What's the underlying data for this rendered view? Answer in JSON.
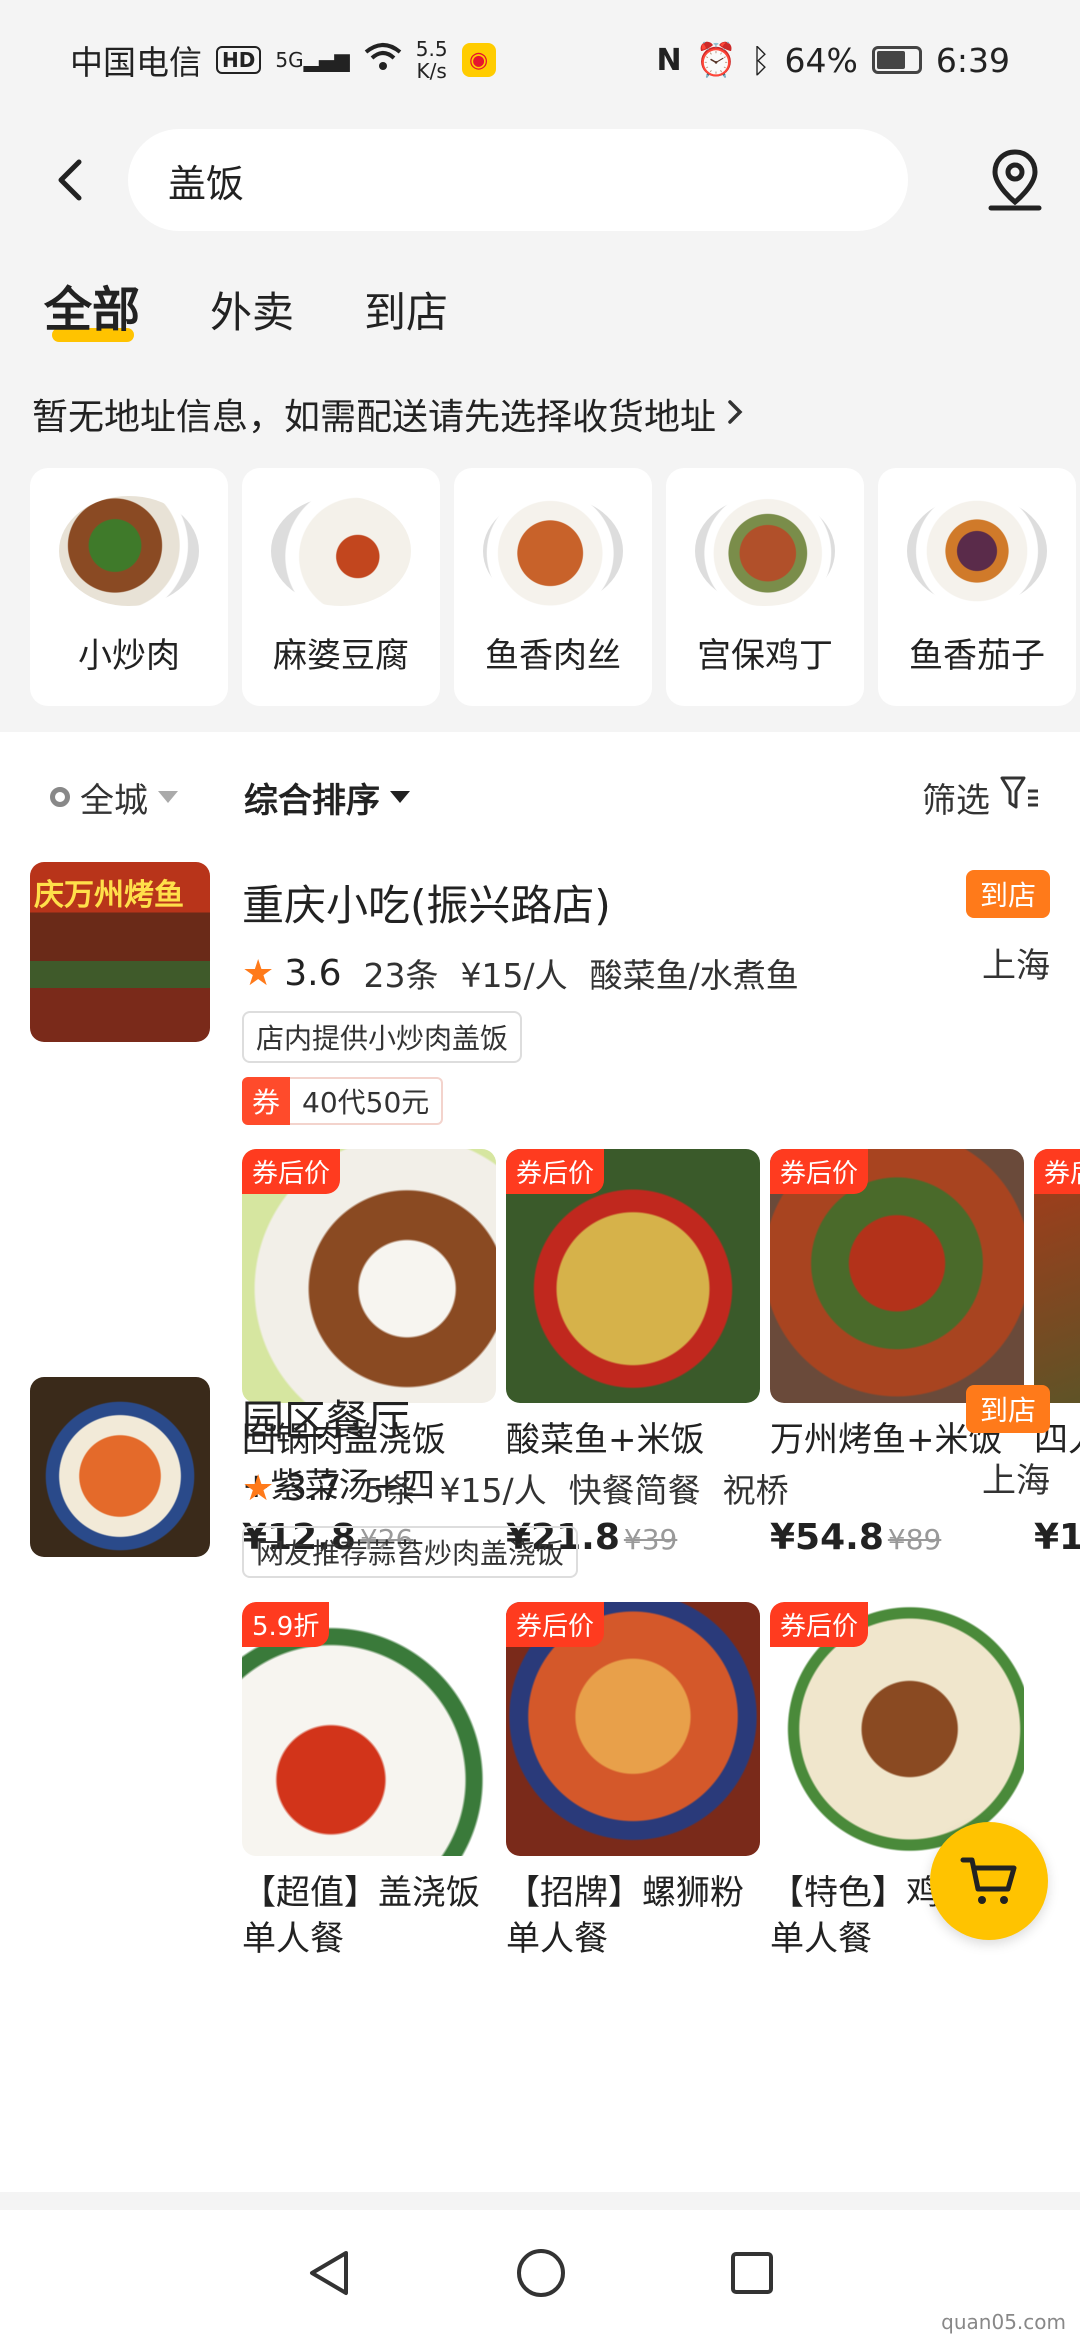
{
  "status_bar": {
    "carrier": "中国电信",
    "hd": "HD",
    "signal": "5G",
    "net_speed_top": "5.5",
    "net_speed_bottom": "K/s",
    "battery": "64%",
    "time": "6:39"
  },
  "search": {
    "query": "盖饭"
  },
  "tabs": [
    {
      "label": "全部",
      "active": true
    },
    {
      "label": "外卖",
      "active": false
    },
    {
      "label": "到店",
      "active": false
    }
  ],
  "address_hint": "暂无地址信息，如需配送请先选择收货地址",
  "dish_categories": [
    {
      "label": "小炒肉"
    },
    {
      "label": "麻婆豆腐"
    },
    {
      "label": "鱼香肉丝"
    },
    {
      "label": "宫保鸡丁"
    },
    {
      "label": "鱼香茄子"
    }
  ],
  "filters": {
    "city": "全城",
    "sort": "综合排序",
    "screen": "筛选"
  },
  "shops": [
    {
      "name": "重庆小吃(振兴路店)",
      "tag": "到店",
      "city": "上海",
      "rating": "3.6",
      "reviews": "23条",
      "price_per": "¥15/人",
      "category": "酸菜鱼/水煮鱼",
      "thumb_text": "庆万州烤鱼",
      "rec": "店内提供小炒肉盖饭",
      "coupon_mark": "券",
      "coupon_text": "40代50元",
      "products": [
        {
          "badge": "券后价",
          "name": "回锅肉盖浇饭+紫菜汤+四川...",
          "price": "¥12.8",
          "orig": "¥26"
        },
        {
          "badge": "券后价",
          "name": "酸菜鱼+米饭",
          "price": "¥21.8",
          "orig": "¥39"
        },
        {
          "badge": "券后价",
          "name": "万州烤鱼+米饭",
          "price": "¥54.8",
          "orig": "¥89"
        },
        {
          "badge": "券后",
          "name": "四人",
          "price": "¥1",
          "orig": ""
        }
      ]
    },
    {
      "name": "园区餐厅",
      "tag": "到店",
      "city": "上海",
      "rating": "3.7",
      "reviews": "5条",
      "price_per": "¥15/人",
      "category": "快餐简餐",
      "area": "祝桥",
      "rec": "网友推荐蒜苔炒肉盖浇饭",
      "products": [
        {
          "badge": "5.9折",
          "name": "【超值】盖浇饭单人餐"
        },
        {
          "badge": "券后价",
          "name": "【招牌】螺狮粉单人餐"
        },
        {
          "badge": "券后价",
          "name": "【特色】鸡杂面单人餐"
        }
      ]
    }
  ],
  "watermark": "quan05.com"
}
